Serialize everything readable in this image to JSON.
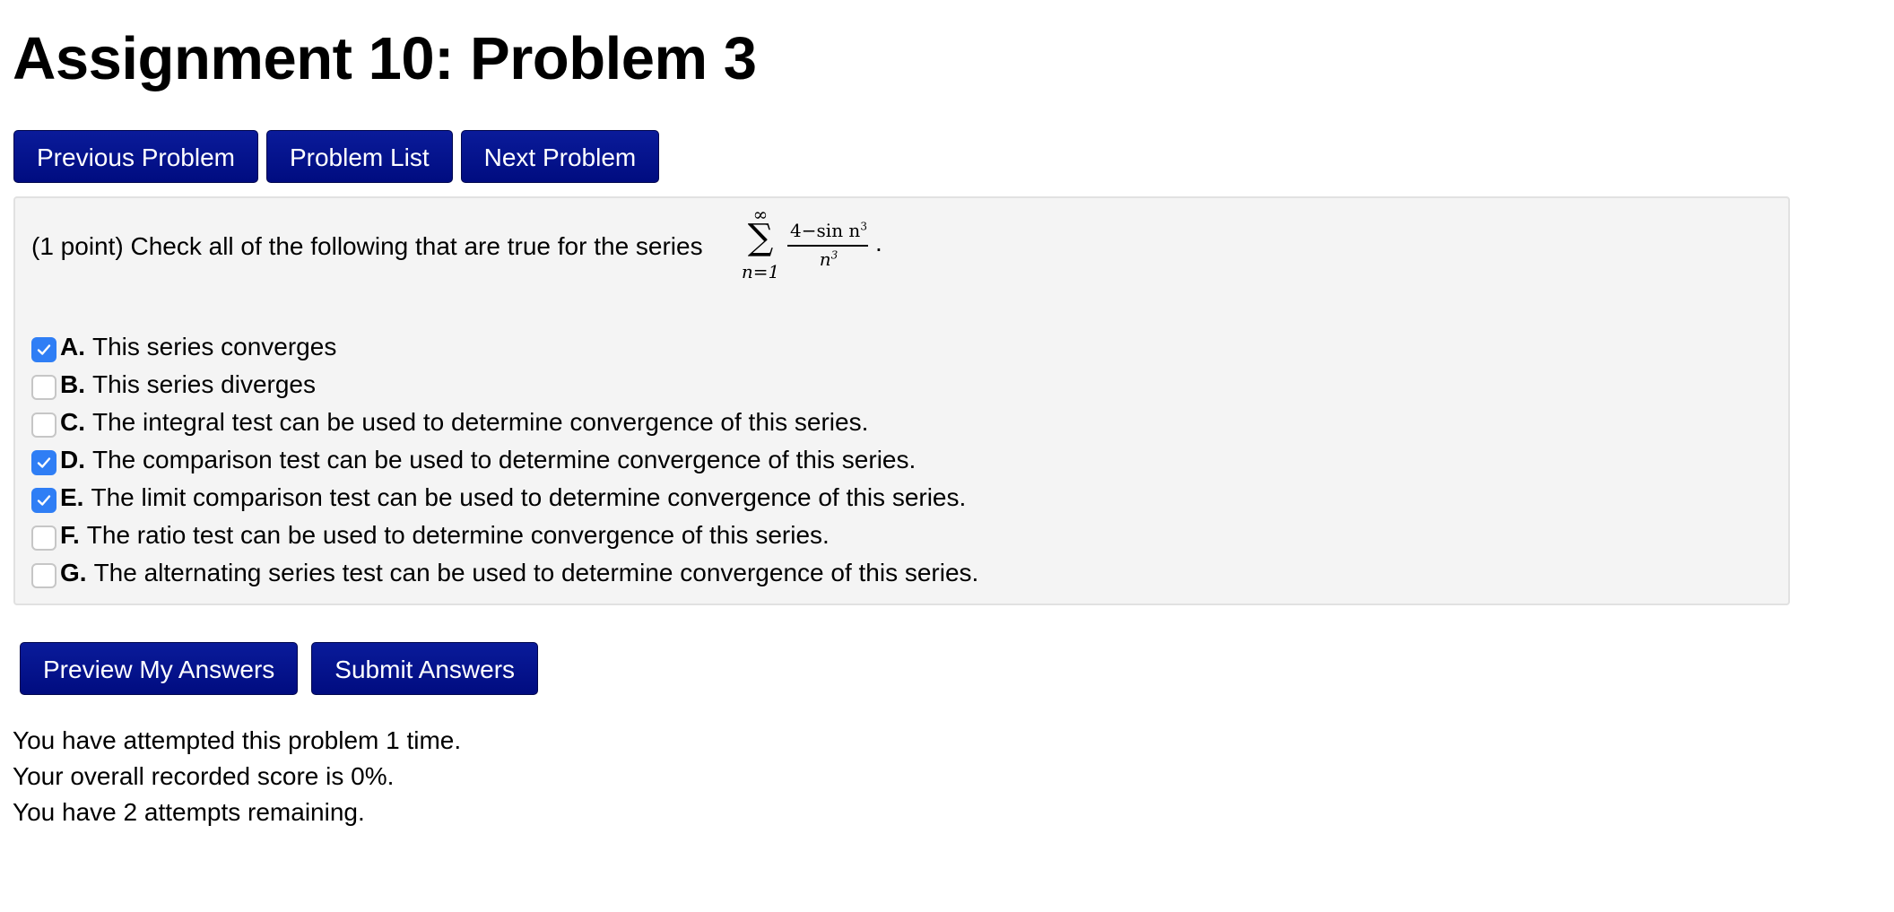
{
  "page": {
    "title": "Assignment 10: Problem 3"
  },
  "nav": {
    "previous_label": "Previous Problem",
    "list_label": "Problem List",
    "next_label": "Next Problem"
  },
  "problem": {
    "prompt": "(1 point) Check all of the following that are true for the series",
    "series": {
      "upper_limit": "∞",
      "sigma": "∑",
      "lower_limit": "n=1",
      "numerator": "4−sin n",
      "numerator_exponent": "3",
      "denominator": "n",
      "denominator_exponent": "3",
      "trailing": "."
    },
    "options": [
      {
        "letter": "A.",
        "text": "This series converges",
        "checked": true
      },
      {
        "letter": "B.",
        "text": "This series diverges",
        "checked": false
      },
      {
        "letter": "C.",
        "text": "The integral test can be used to determine convergence of this series.",
        "checked": false
      },
      {
        "letter": "D.",
        "text": "The comparison test can be used to determine convergence of this series.",
        "checked": true
      },
      {
        "letter": "E.",
        "text": "The limit comparison test can be used to determine convergence of this series.",
        "checked": true
      },
      {
        "letter": "F.",
        "text": "The ratio test can be used to determine convergence of this series.",
        "checked": false
      },
      {
        "letter": "G.",
        "text": "The alternating series test can be used to determine convergence of this series.",
        "checked": false
      }
    ]
  },
  "actions": {
    "preview_label": "Preview My Answers",
    "submit_label": "Submit Answers"
  },
  "status": {
    "attempts_line": "You have attempted this problem 1 time.",
    "score_line": "Your overall recorded score is 0%.",
    "remaining_line": "You have 2 attempts remaining."
  },
  "colors": {
    "button_bg": "#000c80",
    "checkbox_checked": "#2f7ef5",
    "panel_bg": "#f4f4f4"
  }
}
